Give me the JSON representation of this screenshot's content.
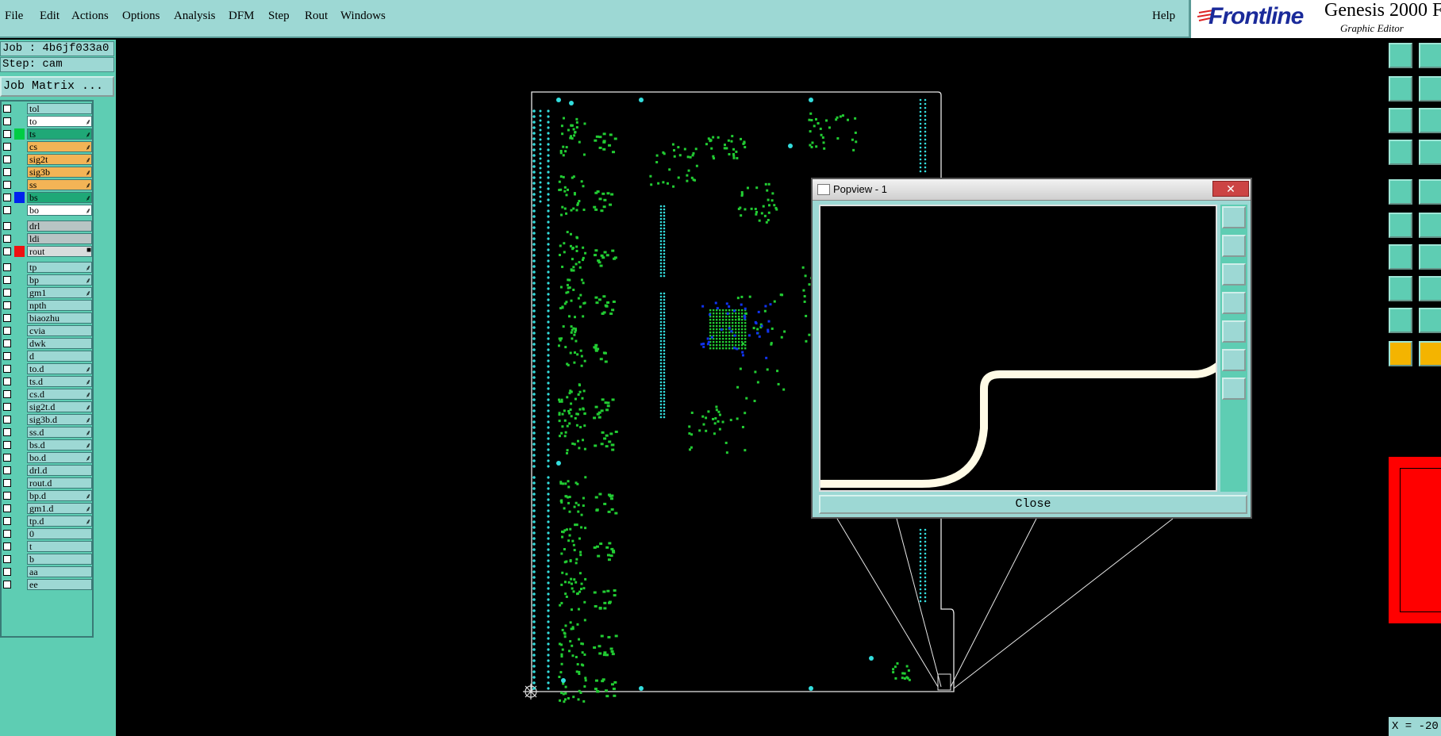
{
  "menubar": {
    "items": [
      "File",
      "Edit",
      "Actions",
      "Options",
      "Analysis",
      "DFM",
      "Step",
      "Rout",
      "Windows"
    ],
    "help": "Help"
  },
  "brand": {
    "logo": "Frontline",
    "product": "Genesis 2000",
    "product_suffix": "F",
    "subtitle": "Graphic Editor"
  },
  "job": {
    "job_line": "Job : 4b6jf033a0",
    "step_line": "Step: cam",
    "matrix_button": "Job Matrix ..."
  },
  "layers": [
    {
      "name": "tol",
      "color": "",
      "bg": "#9dd8d4",
      "mark": ""
    },
    {
      "name": "to",
      "color": "",
      "bg": "#ffffff",
      "mark": "⸙"
    },
    {
      "name": "ts",
      "color": "#00cc44",
      "bg": "#1fa877",
      "mark": "⸙"
    },
    {
      "name": "cs",
      "color": "",
      "bg": "#f3b456",
      "mark": "⸙"
    },
    {
      "name": "sig2t",
      "color": "",
      "bg": "#f3b456",
      "mark": "⸙"
    },
    {
      "name": "sig3b",
      "color": "",
      "bg": "#f3b456",
      "mark": "⸙"
    },
    {
      "name": "ss",
      "color": "",
      "bg": "#f3b456",
      "mark": "⸙"
    },
    {
      "name": "bs",
      "color": "#0022ee",
      "bg": "#1fa877",
      "mark": "⸙"
    },
    {
      "name": "bo",
      "color": "",
      "bg": "#ffffff",
      "mark": "⸙"
    },
    {
      "name": "drl",
      "color": "",
      "bg": "#b8c4c4",
      "mark": ""
    },
    {
      "name": "ldi",
      "color": "",
      "bg": "#b8c4c4",
      "mark": ""
    },
    {
      "name": "rout",
      "color": "#ee1111",
      "bg": "#d8dcdc",
      "mark": "■"
    },
    {
      "name": "tp",
      "color": "",
      "bg": "#9dd8d4",
      "mark": "⸙"
    },
    {
      "name": "bp",
      "color": "",
      "bg": "#9dd8d4",
      "mark": "⸙"
    },
    {
      "name": "gm1",
      "color": "",
      "bg": "#9dd8d4",
      "mark": "⸙"
    },
    {
      "name": "npth",
      "color": "",
      "bg": "#9dd8d4",
      "mark": ""
    },
    {
      "name": "biaozhu",
      "color": "",
      "bg": "#9dd8d4",
      "mark": ""
    },
    {
      "name": "cvia",
      "color": "",
      "bg": "#9dd8d4",
      "mark": ""
    },
    {
      "name": "dwk",
      "color": "",
      "bg": "#9dd8d4",
      "mark": ""
    },
    {
      "name": "d",
      "color": "",
      "bg": "#9dd8d4",
      "mark": ""
    },
    {
      "name": "to.d",
      "color": "",
      "bg": "#9dd8d4",
      "mark": "⸙"
    },
    {
      "name": "ts.d",
      "color": "",
      "bg": "#9dd8d4",
      "mark": "⸙"
    },
    {
      "name": "cs.d",
      "color": "",
      "bg": "#9dd8d4",
      "mark": "⸙"
    },
    {
      "name": "sig2t.d",
      "color": "",
      "bg": "#9dd8d4",
      "mark": "⸙"
    },
    {
      "name": "sig3b.d",
      "color": "",
      "bg": "#9dd8d4",
      "mark": "⸙"
    },
    {
      "name": "ss.d",
      "color": "",
      "bg": "#9dd8d4",
      "mark": "⸙"
    },
    {
      "name": "bs.d",
      "color": "",
      "bg": "#9dd8d4",
      "mark": "⸙"
    },
    {
      "name": "bo.d",
      "color": "",
      "bg": "#9dd8d4",
      "mark": "⸙"
    },
    {
      "name": "drl.d",
      "color": "",
      "bg": "#9dd8d4",
      "mark": ""
    },
    {
      "name": "rout.d",
      "color": "",
      "bg": "#9dd8d4",
      "mark": ""
    },
    {
      "name": "bp.d",
      "color": "",
      "bg": "#9dd8d4",
      "mark": "⸙"
    },
    {
      "name": "gm1.d",
      "color": "",
      "bg": "#9dd8d4",
      "mark": "⸙"
    },
    {
      "name": "tp.d",
      "color": "",
      "bg": "#9dd8d4",
      "mark": "⸙"
    },
    {
      "name": "0",
      "color": "",
      "bg": "#9dd8d4",
      "mark": ""
    },
    {
      "name": "t",
      "color": "",
      "bg": "#9dd8d4",
      "mark": ""
    },
    {
      "name": "b",
      "color": "",
      "bg": "#9dd8d4",
      "mark": ""
    },
    {
      "name": "aa",
      "color": "",
      "bg": "#9dd8d4",
      "mark": ""
    },
    {
      "name": "ee",
      "color": "",
      "bg": "#9dd8d4",
      "mark": ""
    }
  ],
  "popview": {
    "title": "Popview - 1",
    "close_x": "✕",
    "close_button": "Close"
  },
  "status": {
    "coord": "X = -20"
  },
  "colors": {
    "panel": "#9dd8d4",
    "panel_dark": "#5ecdb3",
    "pad_green": "#22cc33",
    "pad_cyan": "#33dddd",
    "pad_blue": "#1133ee",
    "route": "#fffbe6"
  }
}
